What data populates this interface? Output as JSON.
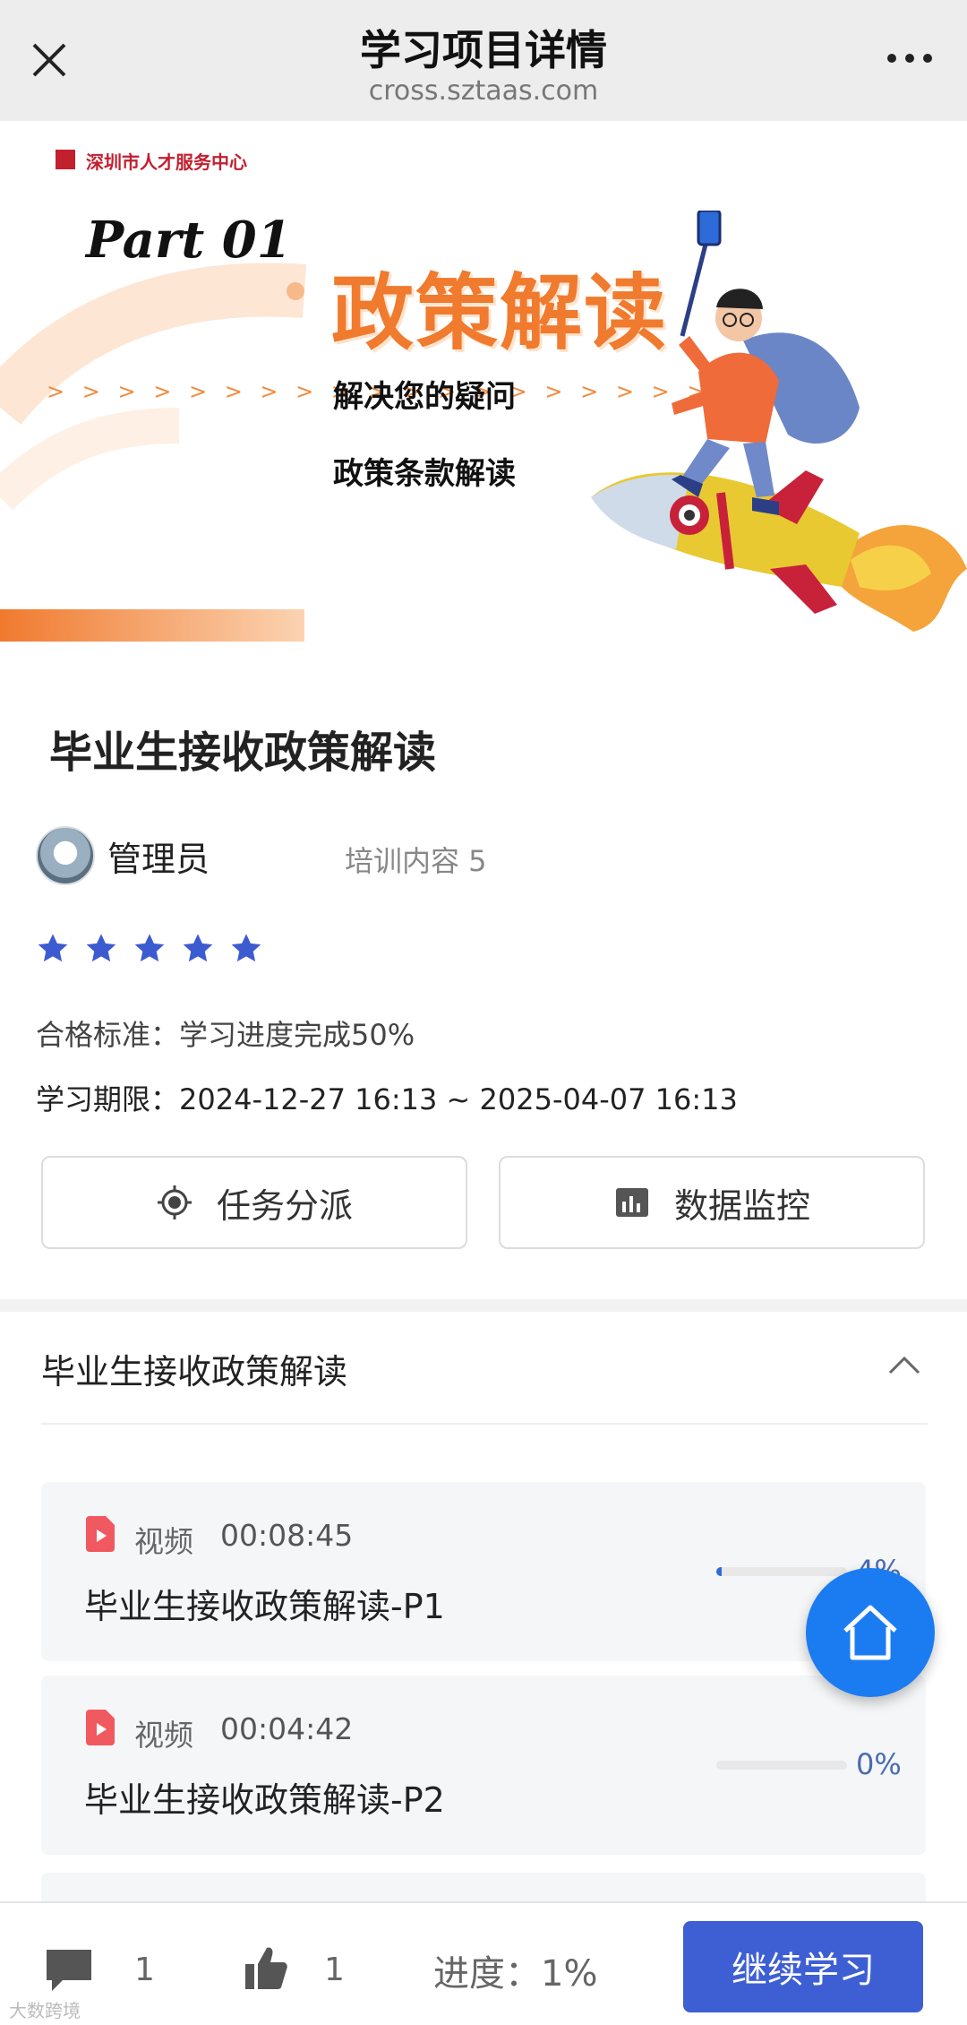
{
  "topbar": {
    "title": "学习项目详情",
    "url": "cross.sztaas.com"
  },
  "banner": {
    "org_name": "深圳市人才服务中心",
    "part": "Part 01",
    "headline": "政策解读",
    "chevrons": "> > > > > > > > > > > > > > > > > > > >",
    "line1": "解决您的疑问",
    "line2": "政策条款解读"
  },
  "course": {
    "title": "毕业生接收政策解读",
    "author": "管理员",
    "training_content": "培训内容 5",
    "rating": 5,
    "qualification": "合格标准：学习进度完成50%",
    "period": "学习期限：2024-12-27 16:13 ~ 2025-04-07 16:13"
  },
  "actions": {
    "assign_label": "任务分派",
    "monitor_label": "数据监控"
  },
  "section": {
    "title": "毕业生接收政策解读"
  },
  "lessons": [
    {
      "type": "视频",
      "duration": "00:08:45",
      "name": "毕业生接收政策解读-P1",
      "progress": 0.04,
      "percent_label": "4%"
    },
    {
      "type": "视频",
      "duration": "00:04:42",
      "name": "毕业生接收政策解读-P2",
      "progress": 0.0,
      "percent_label": "0%"
    }
  ],
  "bottombar": {
    "comment_count": "1",
    "like_count": "1",
    "progress": "进度：1%",
    "continue_label": "继续学习"
  },
  "watermark": "大数跨境",
  "colors": {
    "accent": "#3e5fd4",
    "fab": "#1b7cf2",
    "banner_orange": "#f07a2e",
    "star": "#3d5bd0",
    "video_icon": "#f0595f"
  },
  "icons": [
    "close-icon",
    "more-icon",
    "star-icon",
    "target-icon",
    "bar-chart-icon",
    "chevron-up-icon",
    "video-icon",
    "home-icon",
    "comment-icon",
    "thumbs-up-icon"
  ]
}
